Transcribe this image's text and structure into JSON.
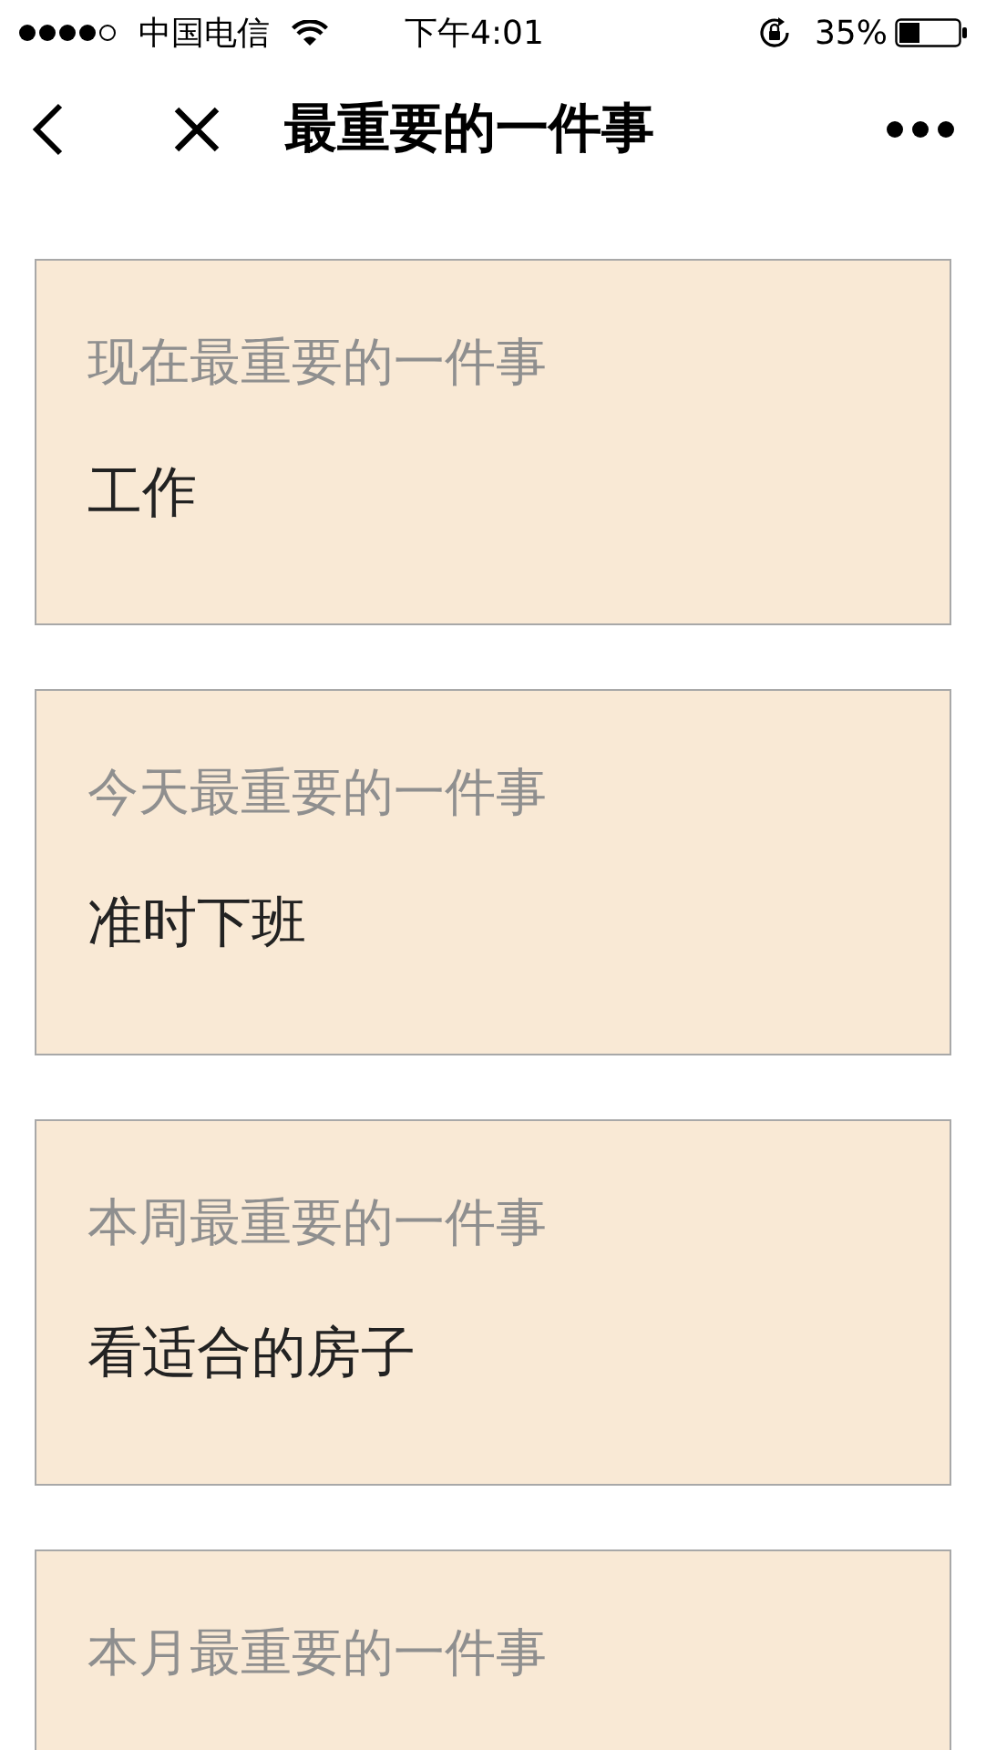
{
  "status_bar": {
    "carrier": "中国电信",
    "time": "下午4:01",
    "battery": "35%"
  },
  "nav_bar": {
    "title": "最重要的一件事"
  },
  "cards": [
    {
      "label": "现在最重要的一件事",
      "value": "工作"
    },
    {
      "label": "今天最重要的一件事",
      "value": "准时下班"
    },
    {
      "label": "本周最重要的一件事",
      "value": "看适合的房子"
    },
    {
      "label": "本月最重要的一件事"
    }
  ]
}
